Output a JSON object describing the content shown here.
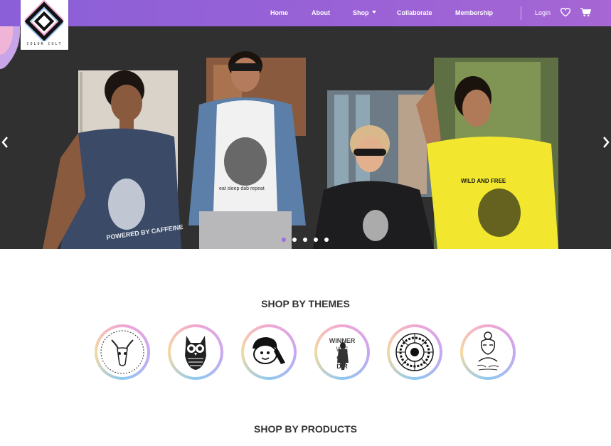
{
  "brand": {
    "name": "COLOR CULT"
  },
  "nav": {
    "links": [
      "Home",
      "About",
      "Shop",
      "Collaborate",
      "Membership"
    ],
    "login": "Login"
  },
  "hero": {
    "slides_count": 5,
    "active_slide": 1,
    "shirt_texts": [
      "POWERED BY CAFFEINE",
      "eat sleep dab repeat",
      "WILD AND FREE"
    ]
  },
  "sections": {
    "themes_title": "SHOP BY THEMES",
    "products_title": "SHOP BY PRODUCTS"
  },
  "themes": [
    {
      "icon": "goat-skull-icon"
    },
    {
      "icon": "owl-icon"
    },
    {
      "icon": "cartoon-face-icon"
    },
    {
      "icon": "winner-poster-icon",
      "text": "WINNER"
    },
    {
      "icon": "mandala-icon"
    },
    {
      "icon": "girl-sketch-icon"
    }
  ],
  "colors": {
    "nav": "#9a62d6",
    "hero_bg": "#303030",
    "accent": "#9b6fe0",
    "text": "#333333"
  }
}
